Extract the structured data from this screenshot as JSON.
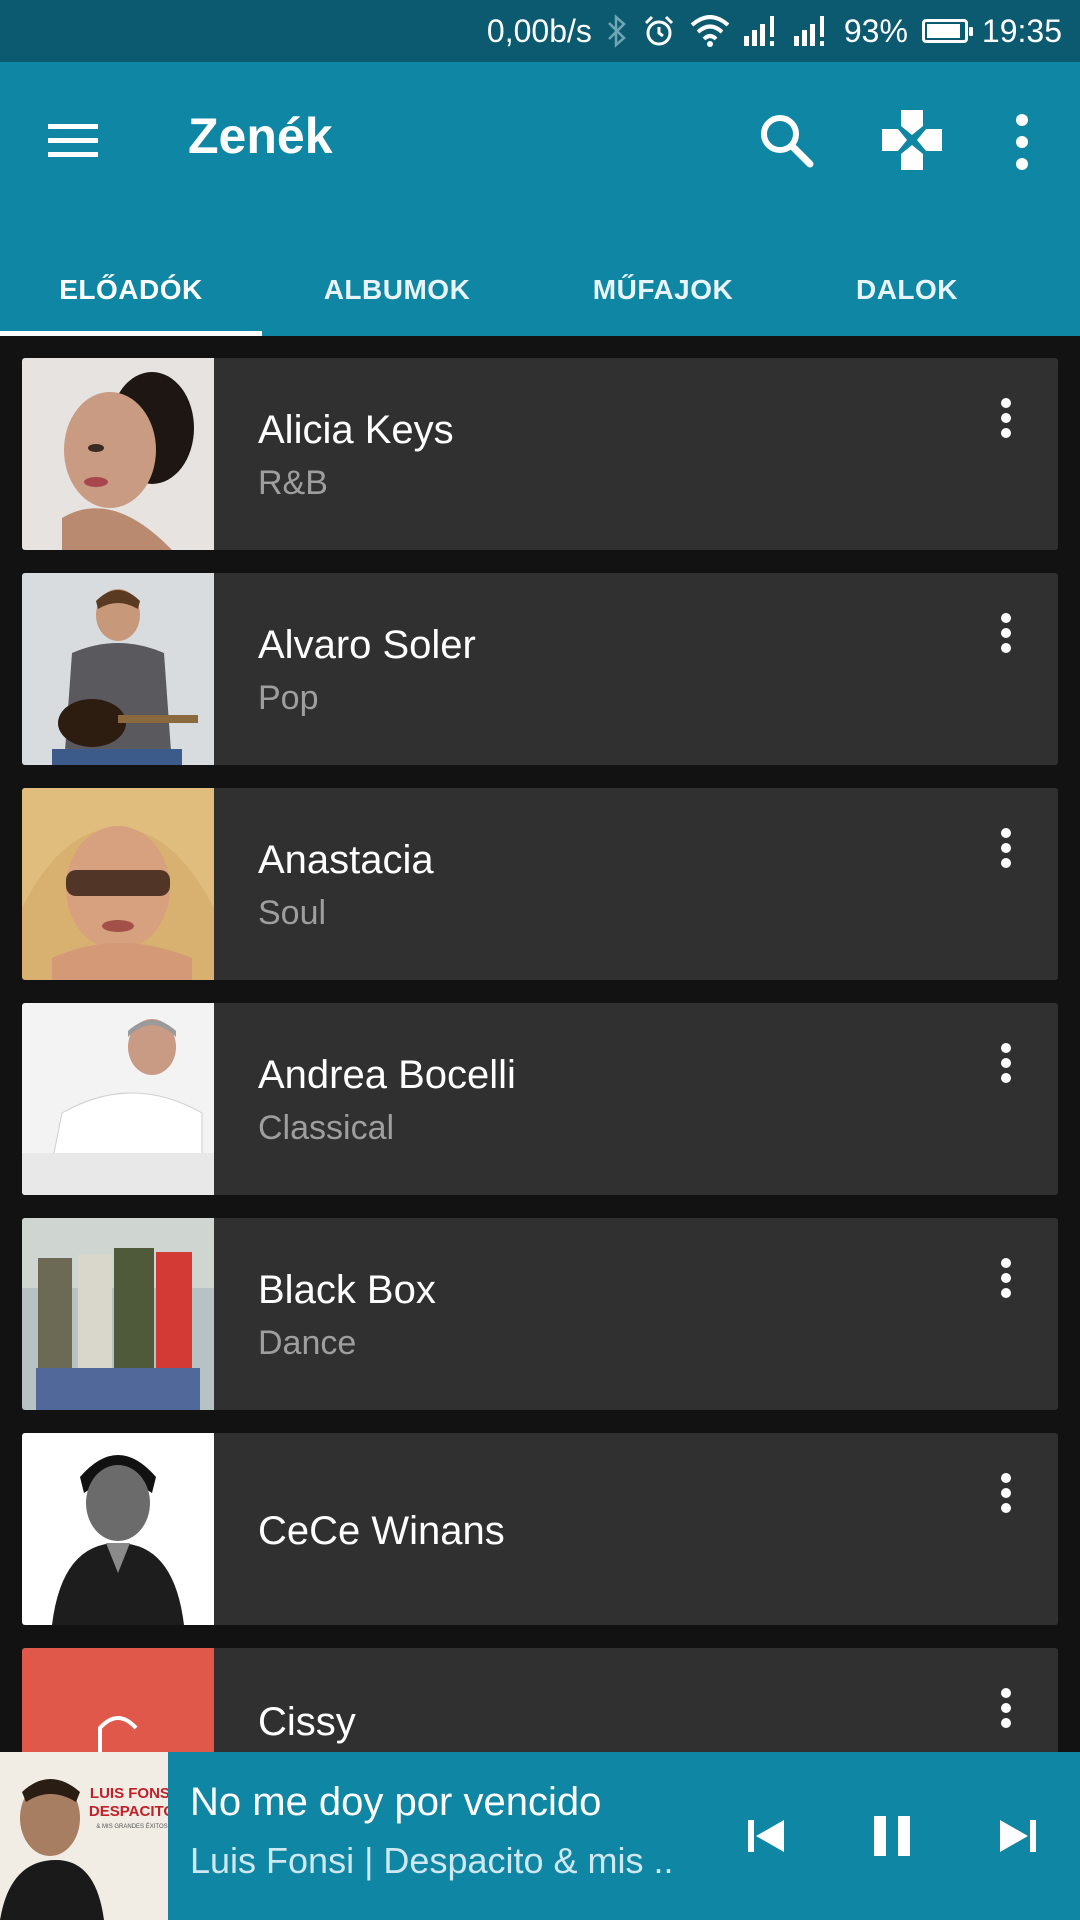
{
  "status_bar": {
    "speed": "0,00b/s",
    "battery_percent": "93%",
    "battery_level": 0.93,
    "time": "19:35",
    "icons": [
      "bluetooth-icon",
      "alarm-icon",
      "wifi-icon",
      "signal-icon",
      "signal-icon",
      "battery-icon"
    ]
  },
  "app_bar": {
    "title": "Zenék",
    "icons": [
      "menu-icon",
      "search-icon",
      "gamepad-icon",
      "more-vert-icon"
    ]
  },
  "tabs": [
    {
      "label": "ELŐADÓK",
      "selected": true
    },
    {
      "label": "ALBUMOK",
      "selected": false
    },
    {
      "label": "MŰFAJOK",
      "selected": false
    },
    {
      "label": "DALOK",
      "selected": false
    }
  ],
  "artists": [
    {
      "name": "Alicia Keys",
      "genre": "R&B"
    },
    {
      "name": "Alvaro Soler",
      "genre": "Pop"
    },
    {
      "name": "Anastacia",
      "genre": "Soul"
    },
    {
      "name": "Andrea Bocelli",
      "genre": "Classical"
    },
    {
      "name": "Black Box",
      "genre": "Dance"
    },
    {
      "name": "CeCe Winans",
      "genre": ""
    },
    {
      "name": "Cissy",
      "genre": ""
    }
  ],
  "now_playing": {
    "title": "No me doy por vencido",
    "subtitle": "Luis Fonsi | Despacito & mis ..",
    "album_art_text": {
      "line1": "LUIS FONSI",
      "line2": "DESPACITO",
      "line3": "& MIS GRANDES ÉXITOS"
    },
    "controls": [
      "skip-previous-icon",
      "pause-icon",
      "skip-next-icon"
    ]
  },
  "colors": {
    "status_bar": "#0c5a6f",
    "primary": "#0e86a4",
    "background": "#121212",
    "card": "#303030",
    "secondary_text": "#9e9e9e"
  }
}
